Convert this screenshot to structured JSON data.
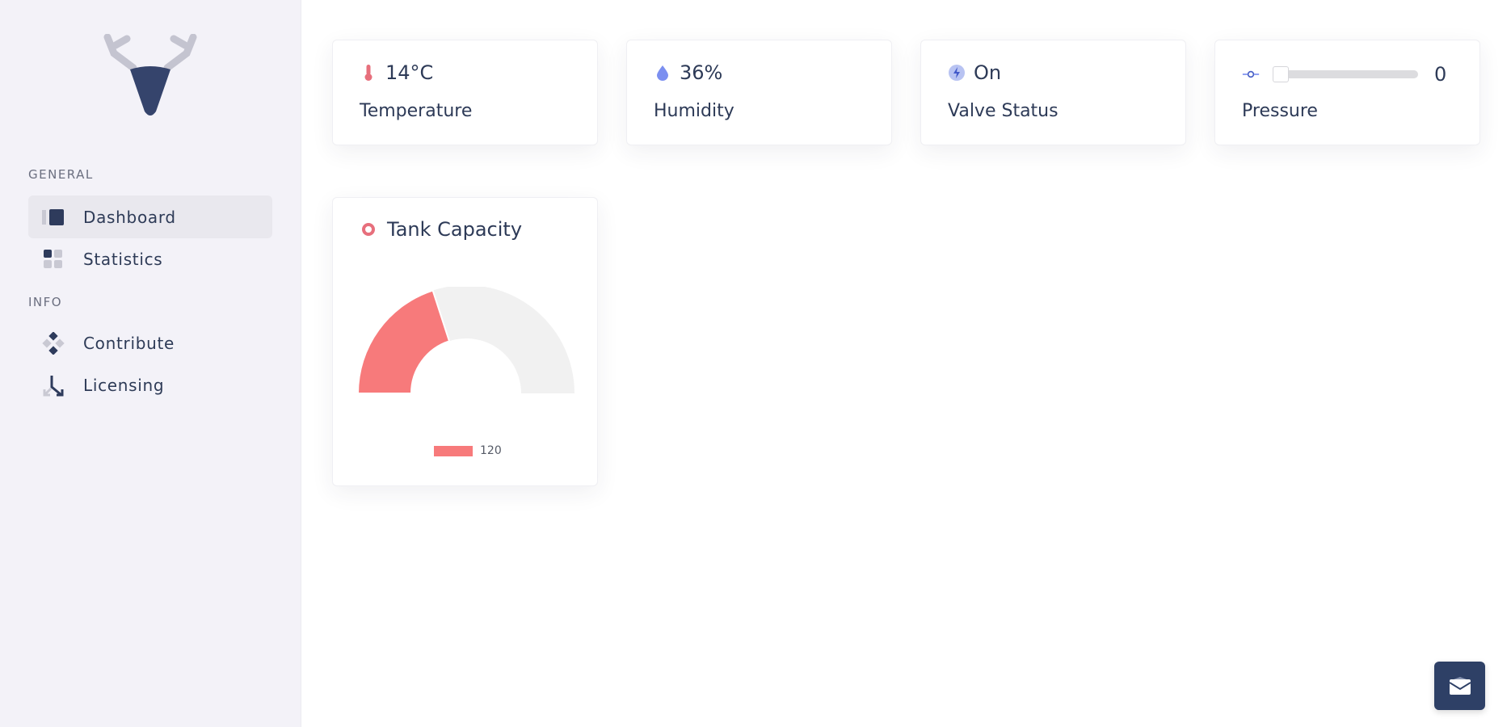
{
  "sidebar": {
    "sections": [
      {
        "label": "GENERAL"
      },
      {
        "label": "INFO"
      }
    ],
    "items": [
      {
        "label": "Dashboard",
        "icon": "dashboard-icon",
        "active": true
      },
      {
        "label": "Statistics",
        "icon": "grid-icon",
        "active": false
      },
      {
        "label": "Contribute",
        "icon": "contribute-icon",
        "active": false
      },
      {
        "label": "Licensing",
        "icon": "merge-arrow-icon",
        "active": false
      }
    ]
  },
  "stats": [
    {
      "value": "14°C",
      "label": "Temperature",
      "icon": "thermometer-icon",
      "color": "#e76f7c"
    },
    {
      "value": "36%",
      "label": "Humidity",
      "icon": "droplet-icon",
      "color": "#7b8ff0"
    },
    {
      "value": "On",
      "label": "Valve Status",
      "icon": "bolt-icon",
      "color": "#5a74e6"
    },
    {
      "value": "0",
      "label": "Pressure",
      "icon": "slider-icon",
      "color": "#4c63c7",
      "slider_level": 0
    }
  ],
  "tank": {
    "title": "Tank Capacity",
    "icon": "ring-icon",
    "colors": {
      "fill": "#f77a7b",
      "remainder": "#f1f1f1"
    }
  },
  "chart_data": {
    "type": "gauge",
    "title": "Tank Capacity",
    "series": [
      {
        "name": "120",
        "value": 120
      }
    ],
    "max": 300
  },
  "fab": {
    "icon": "mail-icon"
  }
}
